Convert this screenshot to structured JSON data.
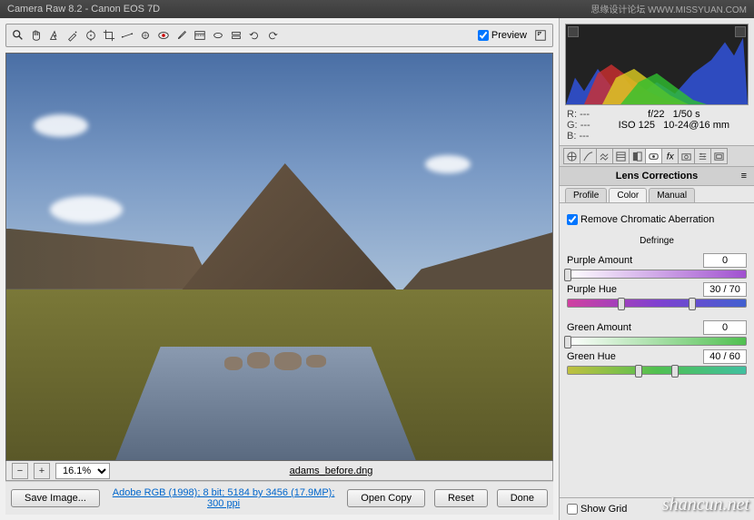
{
  "window": {
    "title": "Camera Raw 8.2  -  Canon EOS 7D"
  },
  "toolbar": {
    "preview_label": "Preview",
    "preview_checked": true
  },
  "preview": {
    "filename": "adams_before.dng",
    "zoom": "16.1%"
  },
  "exif": {
    "r_label": "R:",
    "r_val": "---",
    "g_label": "G:",
    "g_val": "---",
    "b_label": "B:",
    "b_val": "---",
    "aperture": "f/22",
    "shutter": "1/50 s",
    "iso": "ISO 125",
    "lens": "10-24@16 mm"
  },
  "panel": {
    "title": "Lens Corrections",
    "tabs": {
      "profile": "Profile",
      "color": "Color",
      "manual": "Manual"
    },
    "active_tab": "Color",
    "remove_ca_label": "Remove Chromatic Aberration",
    "remove_ca_checked": true,
    "defringe_title": "Defringe",
    "sliders": {
      "purple_amount": {
        "label": "Purple Amount",
        "value": "0"
      },
      "purple_hue": {
        "label": "Purple Hue",
        "value": "30 / 70"
      },
      "green_amount": {
        "label": "Green Amount",
        "value": "0"
      },
      "green_hue": {
        "label": "Green Hue",
        "value": "40 / 60"
      }
    },
    "show_grid_label": "Show Grid",
    "show_grid_checked": false
  },
  "footer": {
    "save_image": "Save Image...",
    "profile_link": "Adobe RGB (1998); 8 bit; 5184 by 3456 (17.9MP); 300 ppi",
    "open_copy": "Open Copy",
    "reset": "Reset",
    "done": "Done"
  },
  "watermarks": {
    "top": "思缘设计论坛  WWW.MISSYUAN.COM",
    "bottom": "shancun.net"
  }
}
